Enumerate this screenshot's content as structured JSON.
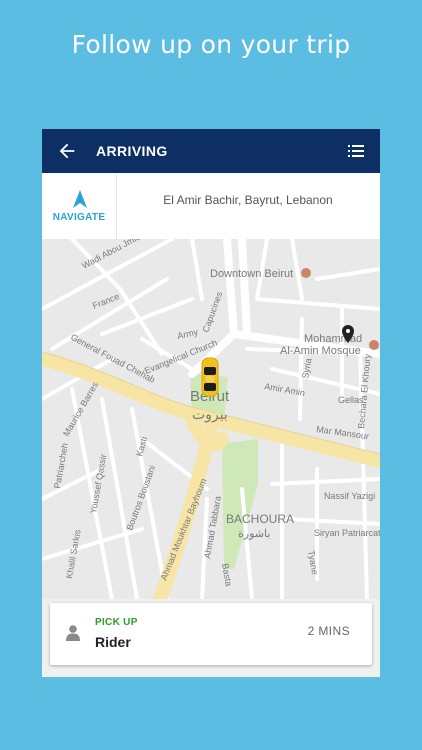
{
  "headline": "Follow up on your trip",
  "appbar": {
    "title": "ARRIVING",
    "back_icon": "arrow-left-icon",
    "menu_icon": "list-icon"
  },
  "navigate": {
    "label": "NAVIGATE",
    "icon": "navigation-arrow-icon",
    "accent": "#29a3d6"
  },
  "address": "El Amir Bachir, Bayrut, Lebanon",
  "map": {
    "labels": {
      "wadi_abou_jmiel": "Wadi Abou Jmiel",
      "france": "France",
      "downtown": "Downtown Beirut",
      "mosque_1": "Mohammad",
      "mosque_2": "Al-Amin Mosque",
      "general": "General Fouad Chehab",
      "army": "Army",
      "capucines": "Capucines",
      "evangelical": "Evangelical Church",
      "beirut_en": "Beirut",
      "beirut_ar": "بيروت",
      "amir_amin": "Amir Amin",
      "syria": "Syria",
      "gellas": "Gellas",
      "mar_mansour": "Mar Mansour",
      "bechara": "Bechara El Khoury",
      "maurice": "Maurice Barres",
      "kasti": "Kasti",
      "patriarcheh": "Patriarcheh",
      "youssef": "Youssef Qassir",
      "boutros": "Boutros Boustani",
      "ahmad": "Ahmad Moukhtar Bayhoum",
      "khalil": "Khalil Sarkis",
      "ahmad_tabbara": "Ahmad Tabbara",
      "bachoura_en": "BACHOURA",
      "bachoura_ar": "باشورة",
      "basta": "Basta",
      "nassif": "Nassif Yazigi",
      "siryan": "Siryan Patriarcat",
      "tyane": "Tyane"
    }
  },
  "trip": {
    "status_label": "PICK UP",
    "rider": "Rider",
    "eta": "2 MINS",
    "status_color": "#2a9d2a"
  },
  "colors": {
    "background": "#5bbde2",
    "appbar": "#0d2f63",
    "road_main": "#f7e5a5"
  }
}
